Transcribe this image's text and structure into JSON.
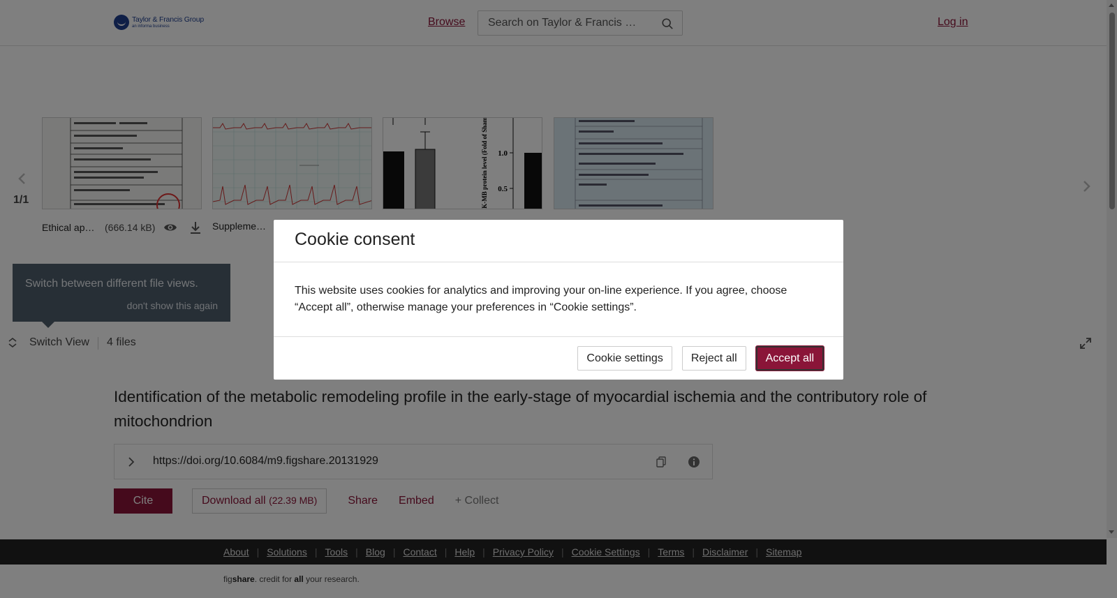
{
  "header": {
    "logo_name": "Taylor & Francis Group",
    "logo_sub": "an informa business",
    "browse": "Browse",
    "search_placeholder": "Search on Taylor & Francis …",
    "login": "Log in"
  },
  "viewer": {
    "pager": "1/1",
    "files": [
      {
        "name": "Ethical approval",
        "size": "(666.14 kB)"
      },
      {
        "name": "Supplementary"
      }
    ],
    "chart_thumb_ylabel": "CK-MB protein level (Fold of Sham)",
    "chart_thumb_ticks": [
      "1.0",
      "0.5"
    ],
    "tooltip_text": "Switch between different file views.",
    "tooltip_link": "don't show this again",
    "switch_view": "Switch View",
    "file_count": "4 files"
  },
  "article": {
    "title": "Identification of the metabolic remodeling profile in the early-stage of myocardial ischemia and the contributory role of mitochondrion",
    "doi": "https://doi.org/10.6084/m9.figshare.20131929",
    "cite": "Cite",
    "download_all": "Download all",
    "download_size": "(22.39 MB)",
    "share": "Share",
    "embed": "Embed",
    "collect": "+ Collect"
  },
  "footer": {
    "links": [
      "About",
      "Solutions",
      "Tools",
      "Blog",
      "Contact",
      "Help",
      "Privacy Policy",
      "Cookie Settings",
      "Terms",
      "Disclaimer",
      "Sitemap"
    ],
    "figshare_pre": "fig",
    "figshare_brand": "share",
    "figshare_mid": ". credit for ",
    "figshare_all": "all",
    "figshare_post": " your research."
  },
  "cookie_modal": {
    "title": "Cookie consent",
    "body": "This website uses cookies for analytics and improving your on-line experience. If you agree, choose “Accept all”, otherwise manage your preferences in “Cookie settings”.",
    "settings": "Cookie settings",
    "reject": "Reject all",
    "accept": "Accept all"
  },
  "colors": {
    "brand": "#8a1538",
    "overlay": "rgba(0,0,0,0.5)"
  }
}
